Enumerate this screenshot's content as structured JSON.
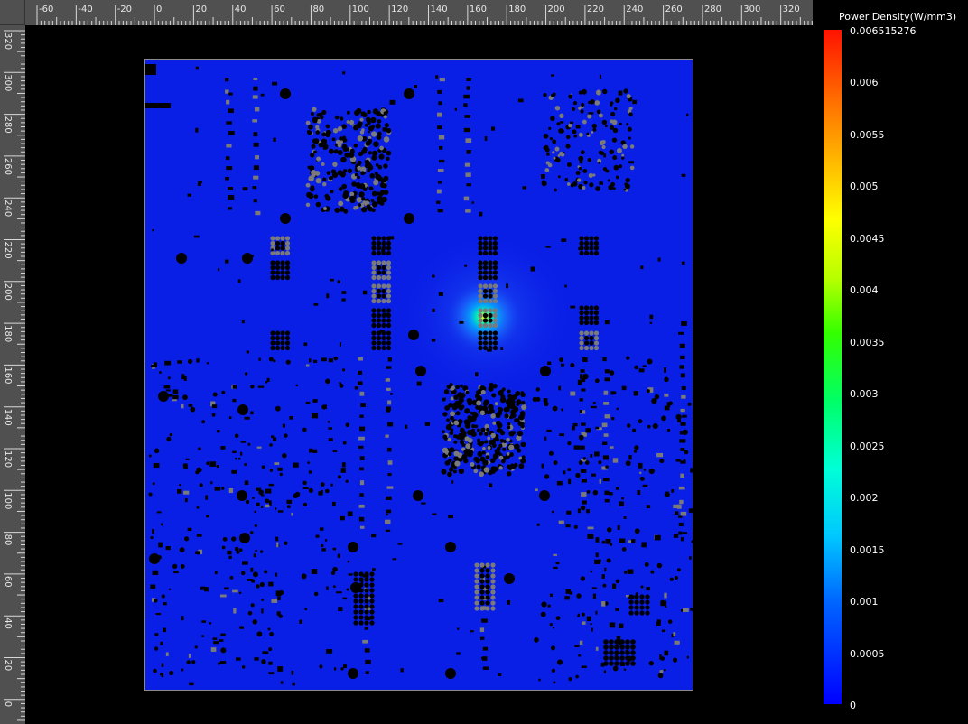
{
  "ruler_top": {
    "labels": [
      "-60",
      "-40",
      "-20",
      "0",
      "20",
      "40",
      "60",
      "80",
      "100",
      "120",
      "140",
      "160",
      "180",
      "200",
      "220",
      "240",
      "260",
      "280",
      "300",
      "320"
    ]
  },
  "ruler_left": {
    "labels": [
      "320",
      "300",
      "280",
      "260",
      "240",
      "220",
      "200",
      "180",
      "160",
      "140",
      "120",
      "100",
      "80",
      "60",
      "40",
      "20",
      "0"
    ]
  },
  "legend": {
    "title": "Power Density(W/mm3)",
    "labels": [
      "0.006515276",
      "0.006",
      "0.0055",
      "0.005",
      "0.0045",
      "0.004",
      "0.0035",
      "0.003",
      "0.0025",
      "0.002",
      "0.0015",
      "0.001",
      "0.0005",
      "0"
    ],
    "colors": {
      "max": "#ff1200",
      "mid": "#33ff00",
      "min": "#0000ff",
      "board": "#0a1fe6",
      "component": "#000000",
      "pad": "#7a7a7a"
    }
  },
  "board": {
    "hotspot_peak": "0.006515276"
  }
}
